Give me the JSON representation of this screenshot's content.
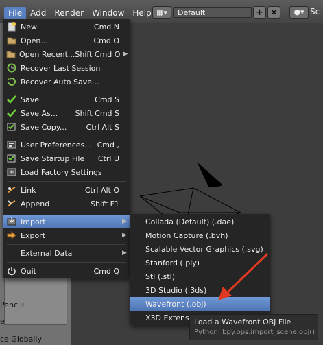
{
  "menubar": {
    "items": [
      "File",
      "Add",
      "Render",
      "Window",
      "Help"
    ],
    "active_index": 0
  },
  "layout_widget": {
    "value": "Default"
  },
  "scene_widget": {
    "label": "Sc"
  },
  "left_panel": {
    "label_pencil": "Pencil:",
    "label_e": "e",
    "label_globally": "ce Globally"
  },
  "file_menu": {
    "items": [
      {
        "label": "New",
        "shortcut": "Cmd N",
        "icon": "new-file-icon",
        "submenu": false
      },
      {
        "label": "Open...",
        "shortcut": "Cmd O",
        "icon": "folder-open-icon",
        "submenu": false
      },
      {
        "label": "Open Recent...",
        "shortcut": "Shift Cmd O",
        "icon": "folder-recent-icon",
        "submenu": true
      },
      {
        "label": "Recover Last Session",
        "shortcut": "",
        "icon": "recover-icon",
        "submenu": false
      },
      {
        "label": "Recover Auto Save...",
        "shortcut": "",
        "icon": "recover-auto-icon",
        "submenu": false
      },
      {
        "label": "Save",
        "shortcut": "Cmd S",
        "icon": "check-icon",
        "submenu": false
      },
      {
        "label": "Save As...",
        "shortcut": "Shift Cmd S",
        "icon": "check-icon",
        "submenu": false
      },
      {
        "label": "Save Copy...",
        "shortcut": "Ctrl Alt S",
        "icon": "save-copy-icon",
        "submenu": false
      },
      {
        "label": "User Preferences...",
        "shortcut": "Cmd ,",
        "icon": "preferences-icon",
        "submenu": false
      },
      {
        "label": "Save Startup File",
        "shortcut": "Ctrl U",
        "icon": "save-startup-icon",
        "submenu": false
      },
      {
        "label": "Load Factory Settings",
        "shortcut": "",
        "icon": "factory-settings-icon",
        "submenu": false
      },
      {
        "label": "Link",
        "shortcut": "Ctrl Alt O",
        "icon": "link-icon",
        "submenu": false
      },
      {
        "label": "Append",
        "shortcut": "Shift F1",
        "icon": "append-icon",
        "submenu": false
      },
      {
        "label": "Import",
        "shortcut": "",
        "icon": "import-icon",
        "submenu": true,
        "highlighted": true
      },
      {
        "label": "Export",
        "shortcut": "",
        "icon": "export-icon",
        "submenu": true
      },
      {
        "label": "External Data",
        "shortcut": "",
        "icon": "external-data-icon",
        "submenu": true
      },
      {
        "label": "Quit",
        "shortcut": "Cmd Q",
        "icon": "power-icon",
        "submenu": false
      }
    ]
  },
  "import_submenu": {
    "items": [
      "Collada (Default) (.dae)",
      "Motion Capture (.bvh)",
      "Scalable Vector Graphics (.svg)",
      "Stanford (.ply)",
      "Stl (.stl)",
      "3D Studio (.3ds)",
      "Wavefront (.obj)",
      "X3D Extensil"
    ],
    "highlighted_index": 6
  },
  "tooltip": {
    "title": "Load a Wavefront OBJ File",
    "python": "Python: bpy.ops.import_scene.obj()"
  },
  "colors": {
    "highlight": "#5a82c2",
    "arrow": "#e03a22"
  }
}
